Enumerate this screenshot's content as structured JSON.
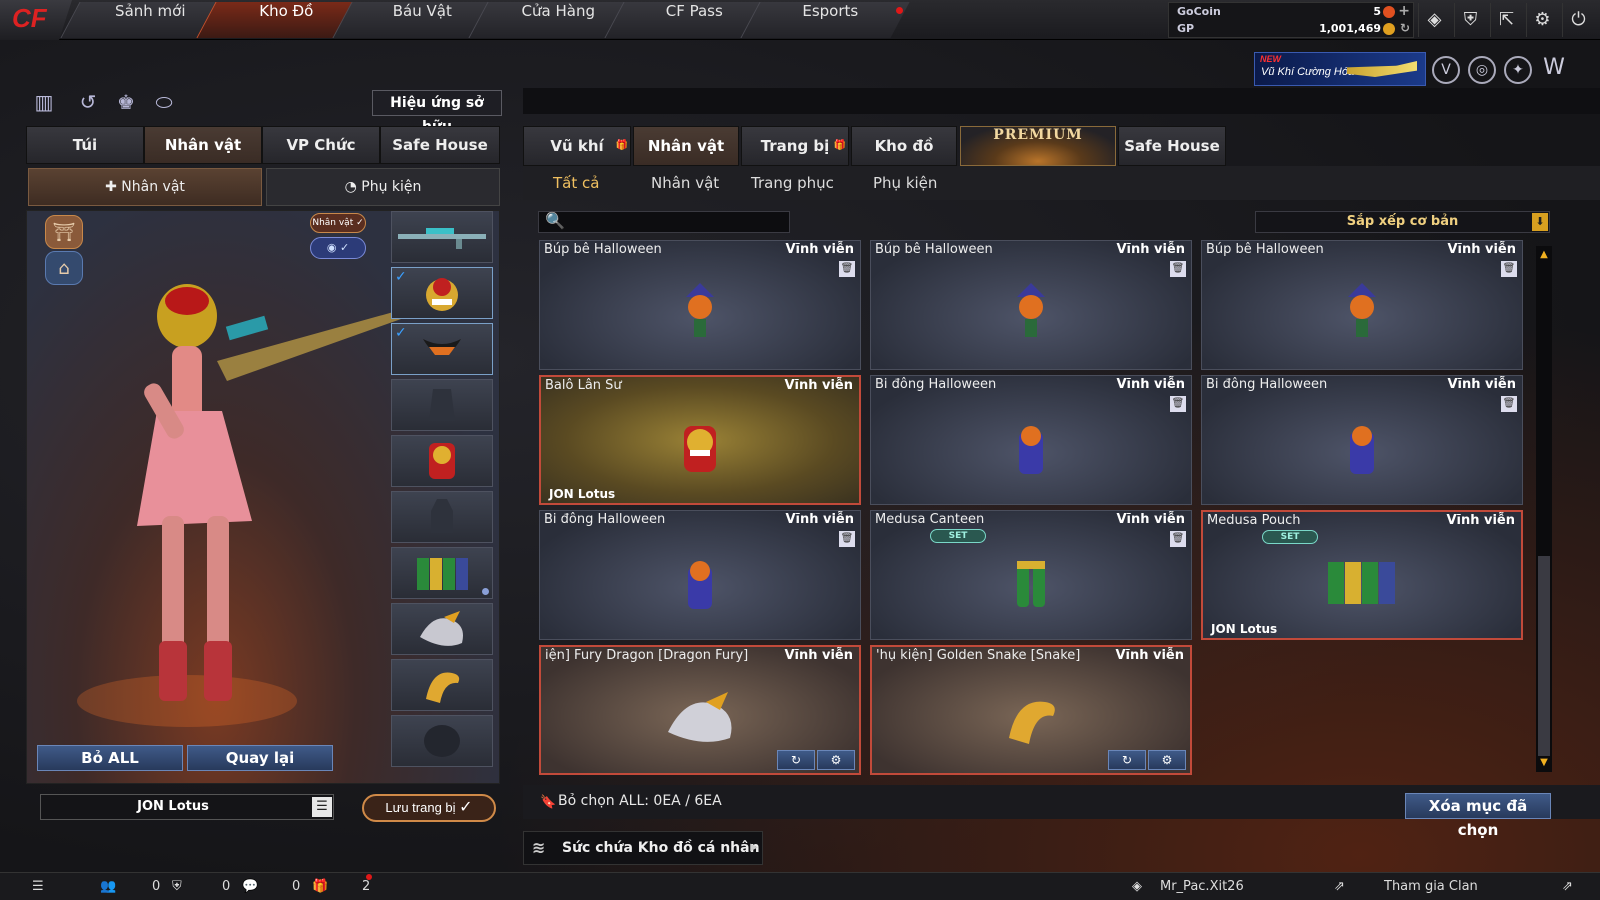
{
  "nav": {
    "tabs": [
      "Sảnh mới",
      "Kho Đồ",
      "Báu Vật",
      "Cửa Hàng",
      "CF Pass",
      "Esports"
    ],
    "active": "Kho Đồ"
  },
  "currency": {
    "gocoin_label": "GoCoin",
    "gocoin_value": "5",
    "gp_label": "GP",
    "gp_value": "1,001,469"
  },
  "promo": {
    "new_label": "NEW",
    "text": "Vũ Khí Cường Hóa"
  },
  "left": {
    "effect_button": "Hiệu ứng sở hữu",
    "tabs": [
      "Túi",
      "Nhân vật",
      "VP Chức năng",
      "Safe House"
    ],
    "subtabs": [
      "Nhân vật",
      "Phụ kiện"
    ],
    "char_badge": "Nhân vật ✓",
    "bo_all": "Bỏ ALL",
    "quay_lai": "Quay lại",
    "player_name": "JON Lotus",
    "save_button": "Lưu trang bị"
  },
  "right": {
    "tabs": [
      "Vũ khí",
      "Nhân vật",
      "Trang bị",
      "Kho đồ",
      "PREMIUM",
      "Safe House"
    ],
    "subtabs": [
      "Tất cả",
      "Nhân vật",
      "Trang phục",
      "Phụ kiện"
    ],
    "sort_label": "Sắp xếp cơ bản",
    "items": [
      {
        "name": "Búp bê Halloween",
        "duration": "Vĩnh viễn"
      },
      {
        "name": "Búp bê Halloween",
        "duration": "Vĩnh viễn"
      },
      {
        "name": "Búp bê Halloween",
        "duration": "Vĩnh viễn"
      },
      {
        "name": "Balô Lân Sư",
        "duration": "Vĩnh viễn",
        "owner": "JON Lotus"
      },
      {
        "name": "Bi đông Halloween",
        "duration": "Vĩnh viễn"
      },
      {
        "name": "Bi đông Halloween",
        "duration": "Vĩnh viễn"
      },
      {
        "name": "Bi đông Halloween",
        "duration": "Vĩnh viễn"
      },
      {
        "name": "Medusa Canteen",
        "duration": "Vĩnh viễn",
        "badge": "SET"
      },
      {
        "name": "Medusa Pouch",
        "duration": "Vĩnh viễn",
        "badge": "SET",
        "owner": "JON Lotus"
      },
      {
        "name": "iện] Fury Dragon [Dragon Fury]",
        "duration": "Vĩnh viễn"
      },
      {
        "name": "'hụ kiện] Golden Snake [Snake]",
        "duration": "Vĩnh viễn"
      }
    ],
    "selection_text": "Bỏ chọn ALL: 0EA / 6EA",
    "delete_button": "Xóa mục đã chọn",
    "capacity_button": "Sức chứa Kho đồ cá nhân"
  },
  "bottom": {
    "count1": "0",
    "count2": "0",
    "count3": "0",
    "count4": "2",
    "username": "Mr_Pac.Xit26",
    "clan": "Tham gia Clan"
  },
  "icons": {
    "logo": "cf-logo",
    "search": "search-icon",
    "trash": "trash-icon",
    "gear": "gear-icon",
    "refresh": "refresh-icon",
    "settings": "settings-icon"
  },
  "colors": {
    "accent": "#f0b020",
    "active_tab": "#7a2a18",
    "selected_border": "#c24a3a",
    "button": "#3f5a88"
  }
}
